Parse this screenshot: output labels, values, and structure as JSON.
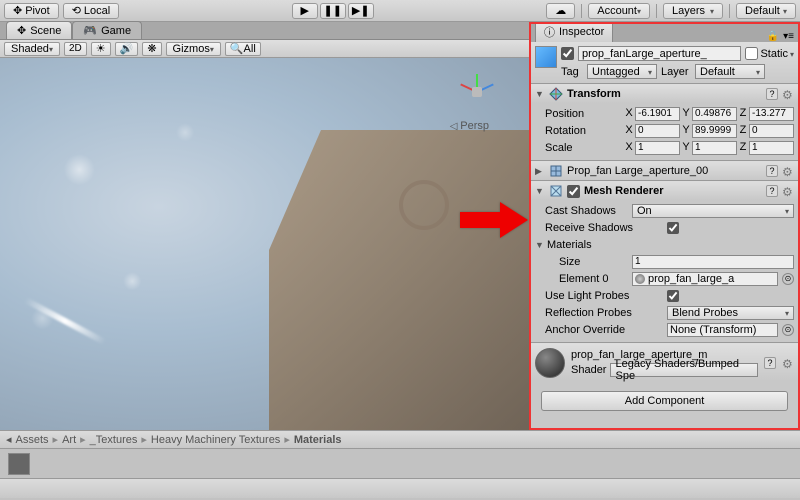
{
  "toolbar": {
    "pivot": "Pivot",
    "local": "Local",
    "account": "Account",
    "layers": "Layers",
    "layout": "Default"
  },
  "scene": {
    "tab_scene": "Scene",
    "tab_game": "Game",
    "shading": "Shaded",
    "twoD": "2D",
    "gizmos": "Gizmos",
    "search_placeholder": "All",
    "persp": "Persp"
  },
  "inspector": {
    "title": "Inspector",
    "object_name": "prop_fanLarge_aperture_",
    "static_label": "Static",
    "tag_label": "Tag",
    "tag_value": "Untagged",
    "layer_label": "Layer",
    "layer_value": "Default"
  },
  "transform": {
    "title": "Transform",
    "position": "Position",
    "rotation": "Rotation",
    "scale": "Scale",
    "pos": {
      "x": "-6.1901",
      "y": "0.49876",
      "z": "-13.277"
    },
    "rot": {
      "x": "0",
      "y": "89.9999",
      "z": "0"
    },
    "scl": {
      "x": "1",
      "y": "1",
      "z": "1"
    }
  },
  "meshfilter": {
    "title": "Prop_fan Large_aperture_00"
  },
  "meshrenderer": {
    "title": "Mesh Renderer",
    "cast_shadows_label": "Cast Shadows",
    "cast_shadows_value": "On",
    "receive_shadows_label": "Receive Shadows",
    "materials_label": "Materials",
    "size_label": "Size",
    "size_value": "1",
    "element0_label": "Element 0",
    "element0_value": "prop_fan_large_a",
    "light_probes_label": "Use Light Probes",
    "reflection_probes_label": "Reflection Probes",
    "reflection_probes_value": "Blend Probes",
    "anchor_label": "Anchor Override",
    "anchor_value": "None (Transform)"
  },
  "material": {
    "name": "prop_fan_large_aperture_m",
    "shader_label": "Shader",
    "shader_value": "Legacy Shaders/Bumped Spe"
  },
  "add_component": "Add Component",
  "breadcrumb": {
    "items": [
      "Assets",
      "Art",
      "_Textures",
      "Heavy Machinery Textures",
      "Materials"
    ]
  },
  "icons": {
    "pivot": "✥",
    "local": "⟲",
    "play": "▶",
    "pause": "❚❚",
    "step": "▶❚",
    "cloud": "☁",
    "info": "ⓘ",
    "lock": "🔒",
    "menu": "≡",
    "gear": "⚙",
    "search": "🔍",
    "light": "☀",
    "audio": "🔊",
    "fx": "❋"
  }
}
